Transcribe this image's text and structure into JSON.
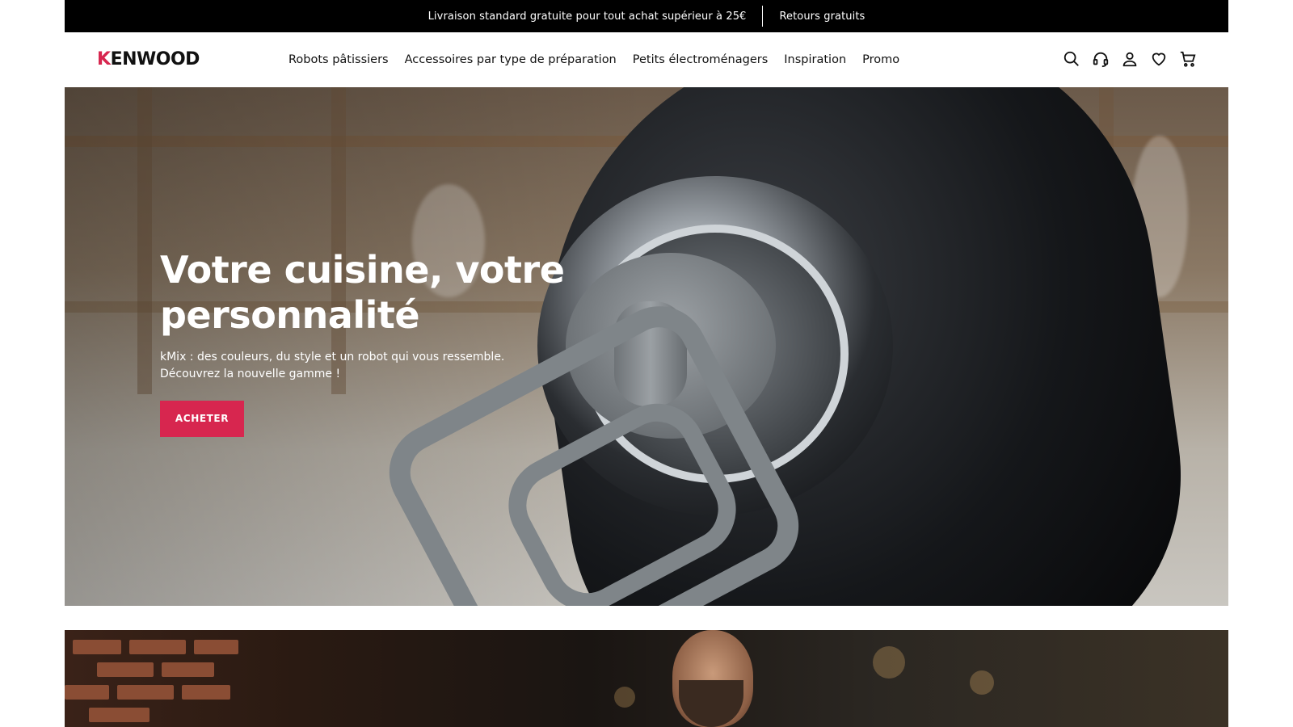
{
  "announcement": {
    "left_text": "Livraison standard gratuite pour tout achat supérieur à 25€",
    "right_text": "Retours gratuits"
  },
  "header": {
    "logo_first": "K",
    "logo_rest": "ENWOOD",
    "nav": [
      {
        "label": "Robots pâtissiers"
      },
      {
        "label": "Accessoires par type de préparation"
      },
      {
        "label": "Petits électroménagers"
      },
      {
        "label": "Inspiration"
      },
      {
        "label": "Promo"
      }
    ],
    "icons": [
      "search-icon",
      "support-headset-icon",
      "account-icon",
      "wishlist-heart-icon",
      "cart-icon"
    ]
  },
  "hero": {
    "title": "Votre cuisine, votre personnalité",
    "subtitle_line1": "kMix : des couleurs, du style et un robot qui vous ressemble.",
    "subtitle_line2": "Découvrez la nouvelle gamme !",
    "cta_label": "ACHETER"
  },
  "colors": {
    "brand_accent": "#d7264f",
    "announcement_bg": "#000000",
    "text": "#111111"
  }
}
